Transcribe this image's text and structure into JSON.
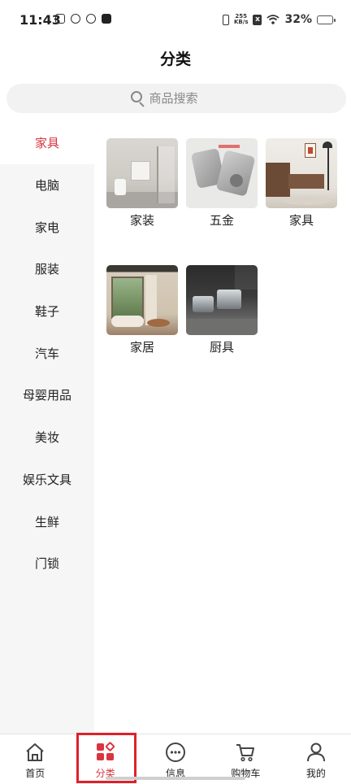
{
  "status_bar": {
    "time": "11:43",
    "net_speed_value": "255",
    "net_speed_unit": "KB/s",
    "battery_percent": "32%",
    "battery_level": 0.32
  },
  "header": {
    "title": "分类"
  },
  "search": {
    "placeholder": "商品搜索"
  },
  "sidebar": {
    "items": [
      {
        "label": "家具",
        "active": true
      },
      {
        "label": "电脑"
      },
      {
        "label": "家电"
      },
      {
        "label": "服装"
      },
      {
        "label": "鞋子"
      },
      {
        "label": "汽车"
      },
      {
        "label": "母婴用品"
      },
      {
        "label": "美妆"
      },
      {
        "label": "娱乐文具"
      },
      {
        "label": "生鲜"
      },
      {
        "label": "门锁"
      }
    ]
  },
  "grid": {
    "items": [
      {
        "label": "家装"
      },
      {
        "label": "五金"
      },
      {
        "label": "家具"
      },
      {
        "label": "家居"
      },
      {
        "label": "厨具"
      }
    ]
  },
  "bottom_nav": {
    "items": [
      {
        "label": "首页",
        "icon": "home-icon"
      },
      {
        "label": "分类",
        "icon": "category-icon",
        "active": true
      },
      {
        "label": "信息",
        "icon": "message-icon"
      },
      {
        "label": "购物车",
        "icon": "cart-icon"
      },
      {
        "label": "我的",
        "icon": "profile-icon"
      }
    ]
  },
  "colors": {
    "accent": "#d9343f",
    "highlight": "#e0202a"
  }
}
